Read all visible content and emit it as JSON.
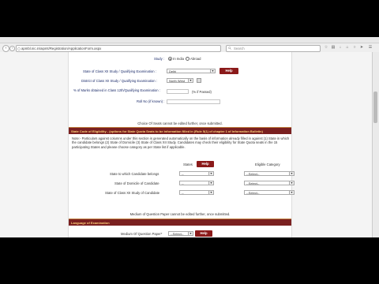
{
  "browser": {
    "url": "apmbl.nic.in/aipmt/Registration/ApplicationForm.aspx",
    "search_placeholder": "Search"
  },
  "form": {
    "study_label": "Study :",
    "study_options": [
      "In India",
      "Abroad"
    ],
    "study_selected": "In India",
    "state_xii_label": "State of Class XII Study / Qualifying Examination :",
    "state_xii_value": "Delhi",
    "district_xii_label": "District of Class XII Study / Qualifying Examination :",
    "district_xii_value": "North West",
    "percent_label": "% of Marks obtained in Class 12th/Qualifying Examination :",
    "percent_hint": "(% if Passed)",
    "rollno_label": "Roll No (if known) :",
    "help_label": "Help"
  },
  "eligibility": {
    "choice_note": "Choice Of Seats cannot be edited further, once submitted.",
    "header": "State Code of Eligibility - (options for State Quota Seats to be information filled in (Rule 5(1) of chapter 1 of Information Bulletin)",
    "note": "Note:- Particulars against columns under this section is generated automatically on the basis of information already filled in against (1) State in which the candidate belongs (2) State of Domicile (3) State of Class XII Study. Candidates may check their eligibility for State Quota seats in the 15 participating States and please choose category as per State list if applicable.",
    "col_states": "States",
    "col_category": "Eligible Category",
    "rows": [
      {
        "label": "State to which Candidate belongs",
        "state": "--",
        "category": "--Select--"
      },
      {
        "label": "State of Domicile of Candidate",
        "state": "--",
        "category": "--Select--"
      },
      {
        "label": "State of Class XII Study of Candidate",
        "state": "--",
        "category": "--Select--"
      }
    ]
  },
  "language": {
    "medium_note": "Medium of Question Paper cannot be edited further, once submitted.",
    "header": "Language of Examination",
    "medium_label": "Medium Of Question Paper*",
    "medium_value": "--Select--"
  }
}
